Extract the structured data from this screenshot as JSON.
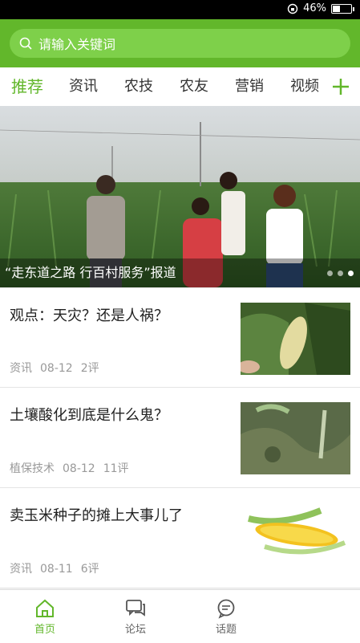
{
  "status": {
    "battery": "46%",
    "battery_level": 0.46
  },
  "search": {
    "placeholder": "请输入关键词"
  },
  "tabs": [
    {
      "label": "推荐",
      "active": true
    },
    {
      "label": "资讯"
    },
    {
      "label": "农技"
    },
    {
      "label": "农友"
    },
    {
      "label": "营销"
    },
    {
      "label": "视频"
    }
  ],
  "banner": {
    "caption": "“走东道之路 行百村服务”报道",
    "slides": 3,
    "active_slide": 3
  },
  "articles": [
    {
      "title": "观点：天灾？还是人祸？",
      "category": "资讯",
      "date": "08-12",
      "comments": "2评"
    },
    {
      "title": "土壤酸化到底是什么鬼？",
      "category": "植保技术",
      "date": "08-12",
      "comments": "11评"
    },
    {
      "title": "卖玉米种子的摊上大事儿了",
      "category": "资讯",
      "date": "08-11",
      "comments": "6评"
    }
  ],
  "nav": [
    {
      "label": "首页",
      "icon": "home-icon",
      "active": true
    },
    {
      "label": "论坛",
      "icon": "forum-icon"
    },
    {
      "label": "话题",
      "icon": "topic-icon"
    }
  ],
  "colors": {
    "brand": "#62b72b",
    "search_bg": "#7ed04a"
  }
}
